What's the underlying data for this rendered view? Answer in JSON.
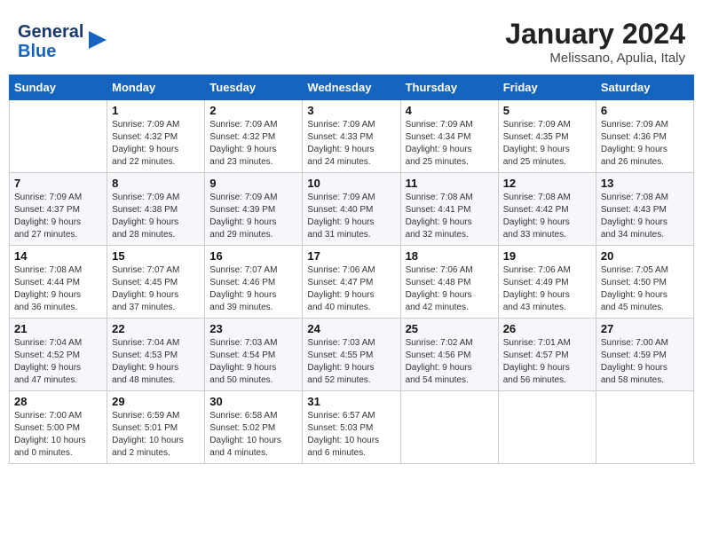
{
  "header": {
    "logo_line1": "General",
    "logo_line2": "Blue",
    "month_title": "January 2024",
    "location": "Melissano, Apulia, Italy"
  },
  "calendar": {
    "days_of_week": [
      "Sunday",
      "Monday",
      "Tuesday",
      "Wednesday",
      "Thursday",
      "Friday",
      "Saturday"
    ],
    "weeks": [
      [
        {
          "day": "",
          "info": ""
        },
        {
          "day": "1",
          "info": "Sunrise: 7:09 AM\nSunset: 4:32 PM\nDaylight: 9 hours\nand 22 minutes."
        },
        {
          "day": "2",
          "info": "Sunrise: 7:09 AM\nSunset: 4:32 PM\nDaylight: 9 hours\nand 23 minutes."
        },
        {
          "day": "3",
          "info": "Sunrise: 7:09 AM\nSunset: 4:33 PM\nDaylight: 9 hours\nand 24 minutes."
        },
        {
          "day": "4",
          "info": "Sunrise: 7:09 AM\nSunset: 4:34 PM\nDaylight: 9 hours\nand 25 minutes."
        },
        {
          "day": "5",
          "info": "Sunrise: 7:09 AM\nSunset: 4:35 PM\nDaylight: 9 hours\nand 25 minutes."
        },
        {
          "day": "6",
          "info": "Sunrise: 7:09 AM\nSunset: 4:36 PM\nDaylight: 9 hours\nand 26 minutes."
        }
      ],
      [
        {
          "day": "7",
          "info": "Sunrise: 7:09 AM\nSunset: 4:37 PM\nDaylight: 9 hours\nand 27 minutes."
        },
        {
          "day": "8",
          "info": "Sunrise: 7:09 AM\nSunset: 4:38 PM\nDaylight: 9 hours\nand 28 minutes."
        },
        {
          "day": "9",
          "info": "Sunrise: 7:09 AM\nSunset: 4:39 PM\nDaylight: 9 hours\nand 29 minutes."
        },
        {
          "day": "10",
          "info": "Sunrise: 7:09 AM\nSunset: 4:40 PM\nDaylight: 9 hours\nand 31 minutes."
        },
        {
          "day": "11",
          "info": "Sunrise: 7:08 AM\nSunset: 4:41 PM\nDaylight: 9 hours\nand 32 minutes."
        },
        {
          "day": "12",
          "info": "Sunrise: 7:08 AM\nSunset: 4:42 PM\nDaylight: 9 hours\nand 33 minutes."
        },
        {
          "day": "13",
          "info": "Sunrise: 7:08 AM\nSunset: 4:43 PM\nDaylight: 9 hours\nand 34 minutes."
        }
      ],
      [
        {
          "day": "14",
          "info": "Sunrise: 7:08 AM\nSunset: 4:44 PM\nDaylight: 9 hours\nand 36 minutes."
        },
        {
          "day": "15",
          "info": "Sunrise: 7:07 AM\nSunset: 4:45 PM\nDaylight: 9 hours\nand 37 minutes."
        },
        {
          "day": "16",
          "info": "Sunrise: 7:07 AM\nSunset: 4:46 PM\nDaylight: 9 hours\nand 39 minutes."
        },
        {
          "day": "17",
          "info": "Sunrise: 7:06 AM\nSunset: 4:47 PM\nDaylight: 9 hours\nand 40 minutes."
        },
        {
          "day": "18",
          "info": "Sunrise: 7:06 AM\nSunset: 4:48 PM\nDaylight: 9 hours\nand 42 minutes."
        },
        {
          "day": "19",
          "info": "Sunrise: 7:06 AM\nSunset: 4:49 PM\nDaylight: 9 hours\nand 43 minutes."
        },
        {
          "day": "20",
          "info": "Sunrise: 7:05 AM\nSunset: 4:50 PM\nDaylight: 9 hours\nand 45 minutes."
        }
      ],
      [
        {
          "day": "21",
          "info": "Sunrise: 7:04 AM\nSunset: 4:52 PM\nDaylight: 9 hours\nand 47 minutes."
        },
        {
          "day": "22",
          "info": "Sunrise: 7:04 AM\nSunset: 4:53 PM\nDaylight: 9 hours\nand 48 minutes."
        },
        {
          "day": "23",
          "info": "Sunrise: 7:03 AM\nSunset: 4:54 PM\nDaylight: 9 hours\nand 50 minutes."
        },
        {
          "day": "24",
          "info": "Sunrise: 7:03 AM\nSunset: 4:55 PM\nDaylight: 9 hours\nand 52 minutes."
        },
        {
          "day": "25",
          "info": "Sunrise: 7:02 AM\nSunset: 4:56 PM\nDaylight: 9 hours\nand 54 minutes."
        },
        {
          "day": "26",
          "info": "Sunrise: 7:01 AM\nSunset: 4:57 PM\nDaylight: 9 hours\nand 56 minutes."
        },
        {
          "day": "27",
          "info": "Sunrise: 7:00 AM\nSunset: 4:59 PM\nDaylight: 9 hours\nand 58 minutes."
        }
      ],
      [
        {
          "day": "28",
          "info": "Sunrise: 7:00 AM\nSunset: 5:00 PM\nDaylight: 10 hours\nand 0 minutes."
        },
        {
          "day": "29",
          "info": "Sunrise: 6:59 AM\nSunset: 5:01 PM\nDaylight: 10 hours\nand 2 minutes."
        },
        {
          "day": "30",
          "info": "Sunrise: 6:58 AM\nSunset: 5:02 PM\nDaylight: 10 hours\nand 4 minutes."
        },
        {
          "day": "31",
          "info": "Sunrise: 6:57 AM\nSunset: 5:03 PM\nDaylight: 10 hours\nand 6 minutes."
        },
        {
          "day": "",
          "info": ""
        },
        {
          "day": "",
          "info": ""
        },
        {
          "day": "",
          "info": ""
        }
      ]
    ]
  }
}
